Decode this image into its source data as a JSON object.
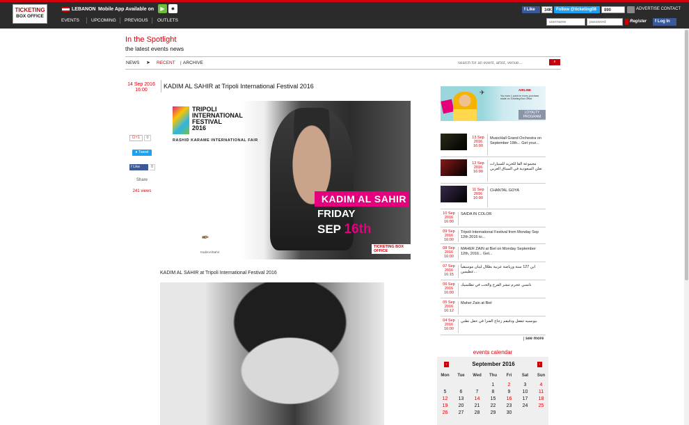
{
  "topbar": {
    "logo_line1": "TICKETING",
    "logo_line2": "BOX OFFICE",
    "country": "LEBANON",
    "mobile_text": "Mobile App Available on",
    "nav": [
      "EVENTS",
      "UPCOMING",
      "PREVIOUS",
      "OUTLETS"
    ],
    "fb_like": "Like",
    "fb_count": "34K",
    "tw_follow": "Follow @ticketing08",
    "followers": "890 follow",
    "advertise": "ADVERTISE CONTACT",
    "username_placeholder": "username",
    "password_placeholder": "password",
    "register": "Register",
    "fb_login": "Log In"
  },
  "header": {
    "title": "In the Spotlight",
    "subtitle": "the latest events news",
    "tabs": {
      "news": "NEWS",
      "recent": "RECENT",
      "sep": "|",
      "archive": "ARCHIVE"
    },
    "search_placeholder": "search for an event, artist, venue...",
    "search_button": "GO"
  },
  "article": {
    "date": "14 Sep 2016",
    "time": "16:00",
    "title": "KADIM AL SAHIR at Tripoli International Festival 2016",
    "gplus": "G+1",
    "gplus_count": "0",
    "tweet": "Tweet",
    "fb_like": "Like",
    "fb_count": "0",
    "share": "Share",
    "views": "241 views",
    "poster": {
      "festival": "TRIPOLI\nINTERNATIONAL\nFESTIVAL\n2016",
      "fair": "RASHID KARAME INTERNATIONAL FAIR",
      "artist": "KADIM AL SAHIR",
      "day": "FRIDAY",
      "month": "SEP",
      "date_num": "16th",
      "box_office": "TICKETING BOX OFFICE",
      "sig_label": "KadimAlSahir"
    },
    "caption": "KADIM AL SAHIR at Tripoli International Festival 2016"
  },
  "promo": {
    "airline": "AIRLINE",
    "info": "You earn 1 point for every purchase made on Ticketing Box Office",
    "loyalty": "LOYALTY PROGRAM"
  },
  "events": [
    {
      "date": "13 Sep 2016",
      "time": "16:00",
      "title": "MusicHall Grand Orchestra on September 19th... Get your...",
      "thumb": "#2a2a18"
    },
    {
      "date": "12 Sep 2016",
      "time": "16:00",
      "title": "مجموعة الفا للخريد للسيارات تعلن السعودية في السباق العربي",
      "thumb": "#8b1a1a"
    },
    {
      "date": "11 Sep 2016",
      "time": "16:00",
      "title": "CHANTAL GOYA",
      "thumb": "#3a2a4a"
    },
    {
      "date": "10 Sep 2016",
      "time": "16:00",
      "title": "SAIDA IN COLOR",
      "thumb": ""
    },
    {
      "date": "09 Sep 2016",
      "time": "16:00",
      "title": "Tripoli International Festival from Monday Sep 12th 2016 to...",
      "thumb": ""
    },
    {
      "date": "08 Sep 2016",
      "time": "16:00",
      "title": "MAHER ZAIN at Biel on Monday September 12th, 2016... Get...",
      "thumb": ""
    },
    {
      "date": "07 Sep 2016",
      "time": "16:15",
      "title": "ابن 127 سنة ورياضة عربية بطلال لبنان موسيقياً عظيمين...",
      "thumb": ""
    },
    {
      "date": "06 Sep 2016",
      "time": "16:00",
      "title": "نانسي عجرم تنشر الفرح والحب في تطلسيك",
      "thumb": ""
    },
    {
      "date": "05 Sep 2016",
      "time": "16:12",
      "title": "Maher Zain at Biel",
      "thumb": ""
    },
    {
      "date": "04 Sep 2016",
      "time": "16:00",
      "title": "بيونسيه تتفعل ودقيقم زجاج الفنزا في حفل نطني",
      "thumb": ""
    }
  ],
  "see_more": "see more",
  "calendar": {
    "heading": "events calendar",
    "month": "September 2016",
    "prev": "‹",
    "next": "›",
    "days": [
      "Mon",
      "Tue",
      "Wed",
      "Thu",
      "Fri",
      "Sat",
      "Sun"
    ],
    "weeks": [
      [
        "",
        "",
        "",
        "1",
        "2",
        "3",
        "4"
      ],
      [
        "5",
        "6",
        "7",
        "8",
        "9",
        "10",
        "11"
      ],
      [
        "12",
        "13",
        "14",
        "15",
        "16",
        "17",
        "18"
      ],
      [
        "19",
        "20",
        "21",
        "22",
        "23",
        "24",
        "25"
      ],
      [
        "26",
        "27",
        "28",
        "29",
        "30",
        "",
        ""
      ]
    ],
    "event_days": [
      "2",
      "4",
      "11",
      "12",
      "14",
      "16",
      "18",
      "19",
      "25",
      "26"
    ],
    "accent": "#d4000b"
  }
}
